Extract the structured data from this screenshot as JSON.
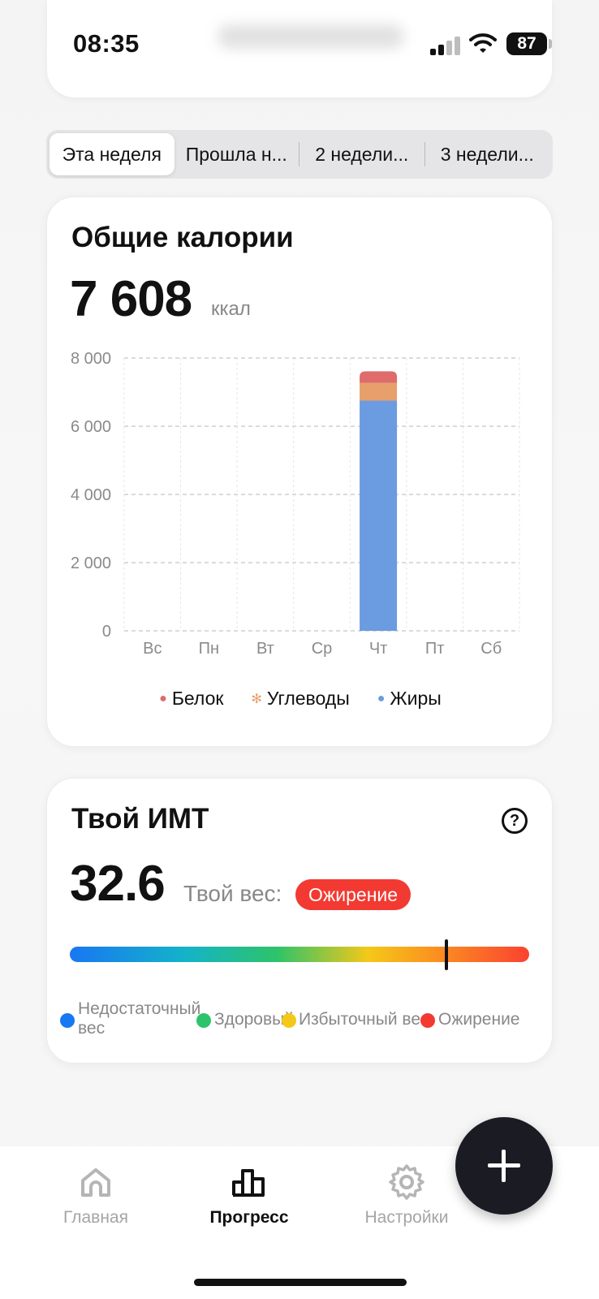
{
  "status_bar": {
    "time": "08:35",
    "battery": "87"
  },
  "tabs": [
    {
      "label": "Эта неделя",
      "active": true
    },
    {
      "label": "Прошла н...",
      "active": false
    },
    {
      "label": "2 недели...",
      "active": false
    },
    {
      "label": "3 недели...",
      "active": false
    }
  ],
  "calories": {
    "title": "Общие калории",
    "total": "7 608",
    "unit": "ккал"
  },
  "chart_data": {
    "type": "bar",
    "stacked": true,
    "categories": [
      "Вс",
      "Пн",
      "Вт",
      "Ср",
      "Чт",
      "Пт",
      "Сб"
    ],
    "y_ticks": [
      "0",
      "2 000",
      "4 000",
      "6 000",
      "8 000"
    ],
    "ylim": [
      0,
      8000
    ],
    "grid": true,
    "series": [
      {
        "name": "Жиры",
        "color": "#6b9be0",
        "values": [
          0,
          0,
          0,
          0,
          6750,
          0,
          0
        ]
      },
      {
        "name": "Углеводы",
        "color": "#e79f6c",
        "values": [
          0,
          0,
          0,
          0,
          520,
          0,
          0
        ]
      },
      {
        "name": "Белок",
        "color": "#df6b6b",
        "values": [
          0,
          0,
          0,
          0,
          340,
          0,
          0
        ]
      }
    ],
    "legend": [
      {
        "name": "Белок",
        "icon": "drumstick-icon",
        "color": "#df6b6b"
      },
      {
        "name": "Углеводы",
        "icon": "wheat-icon",
        "color": "#e79f6c"
      },
      {
        "name": "Жиры",
        "icon": "oil-drop-icon",
        "color": "#6b9be0"
      }
    ]
  },
  "bmi": {
    "title": "Твой ИМТ",
    "value": "32.6",
    "weight_label": "Твой вес:",
    "status": "Ожирение",
    "marker_fraction": 0.82,
    "categories": [
      {
        "label": "Недостаточный вес",
        "color": "#1877f2"
      },
      {
        "label": "Здоровый",
        "color": "#2dc36a"
      },
      {
        "label": "Избыточный вес",
        "color": "#f4c818"
      },
      {
        "label": "Ожирение",
        "color": "#f23a32"
      }
    ]
  },
  "nav": {
    "home": "Главная",
    "progress": "Прогресс",
    "settings": "Настройки"
  }
}
